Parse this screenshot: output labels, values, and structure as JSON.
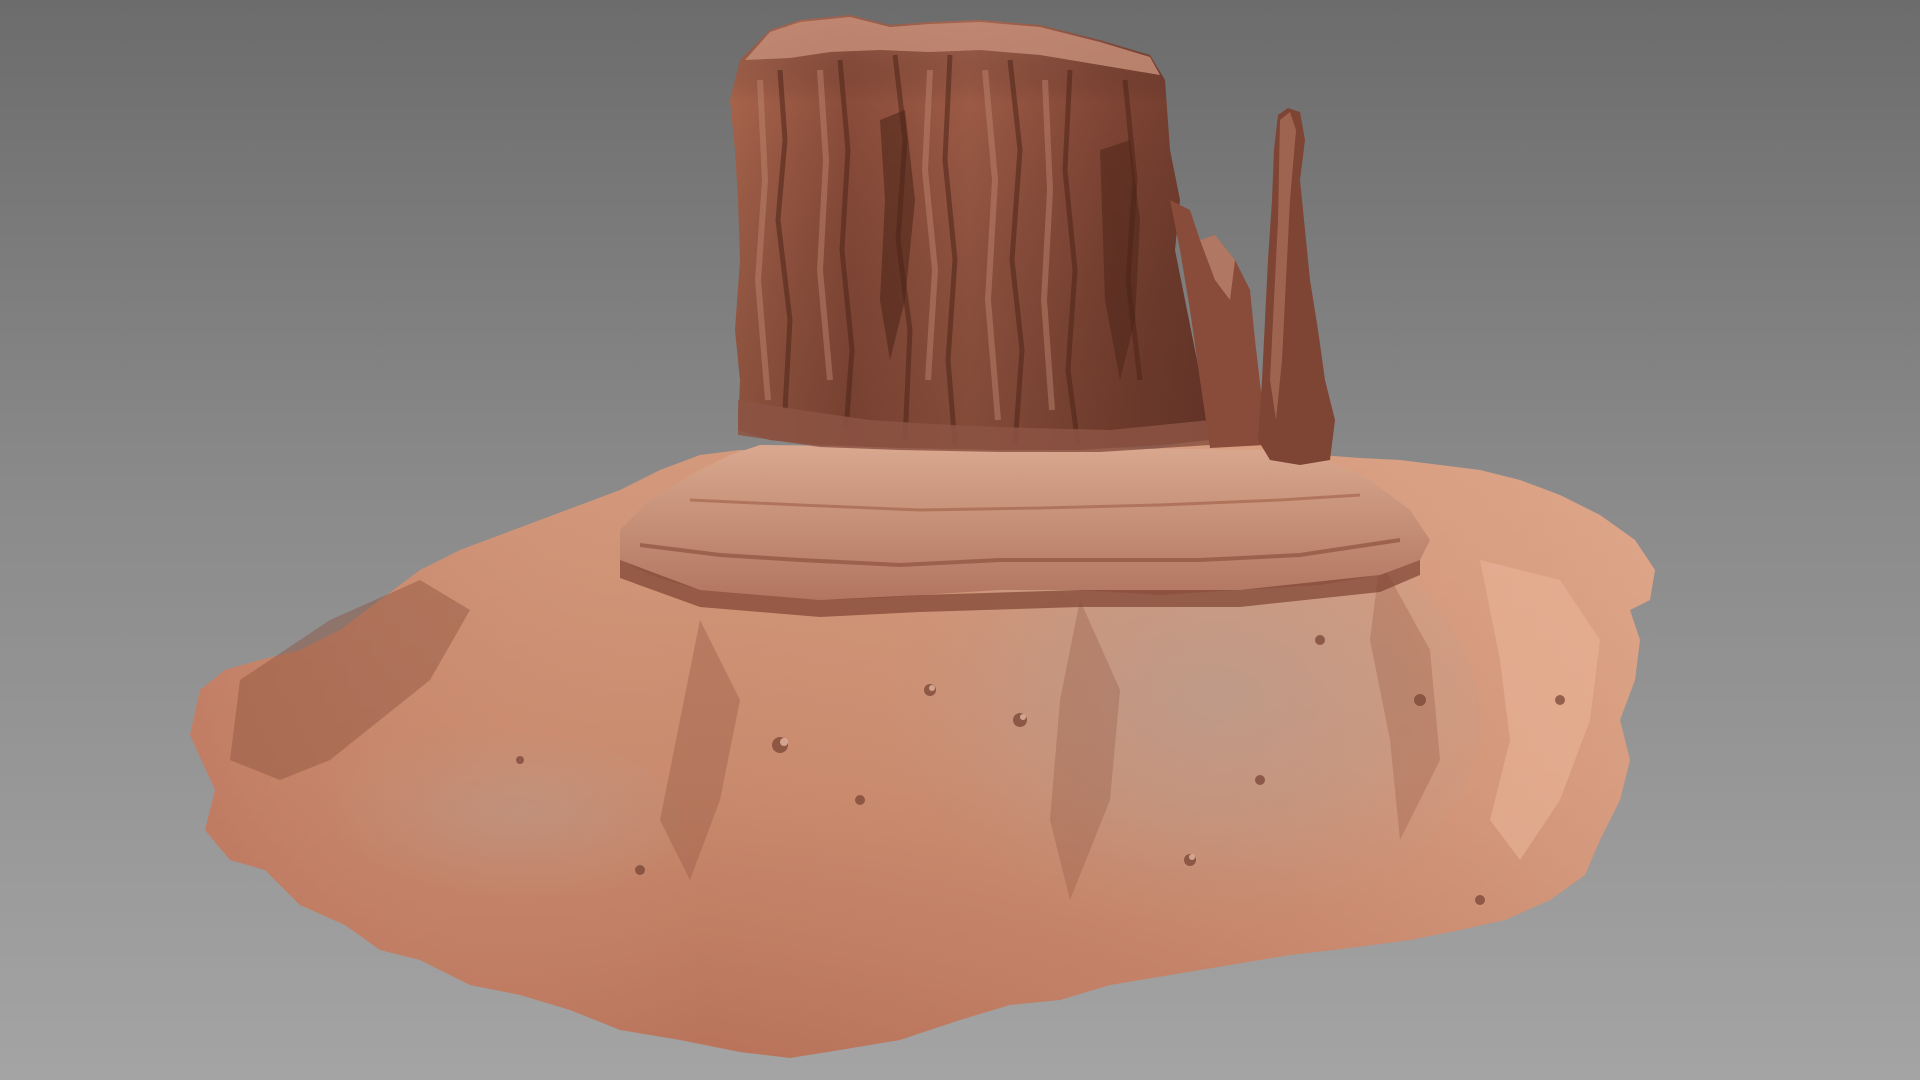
{
  "scene": {
    "subject_icon": "butte-rock-formation-icon",
    "colors": {
      "background_top": "#6c6c6c",
      "background_bottom": "#a4a4a4",
      "rock_dark": "#6e3d2e",
      "rock_mid": "#9a5a44",
      "rock_light": "#c98c70",
      "sand_light": "#dea487",
      "sand_shadow": "#a9664c",
      "talus_gray": "#b89a8c"
    }
  }
}
